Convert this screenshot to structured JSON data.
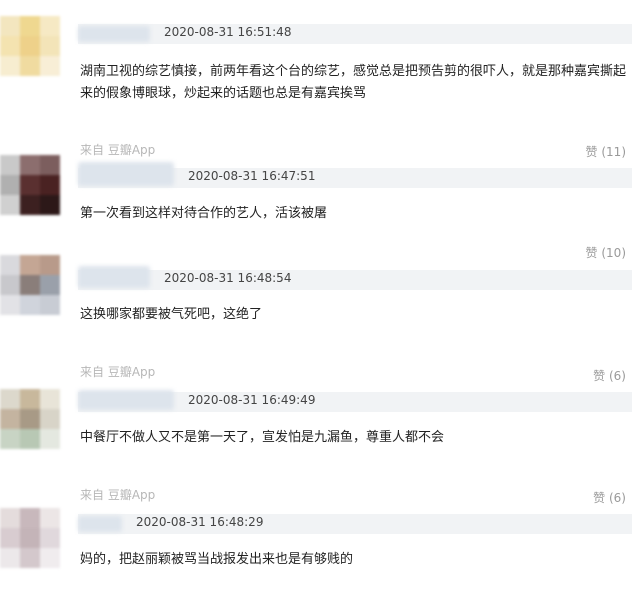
{
  "comments": [
    {
      "time": "2020-08-31 16:51:48",
      "text": "湖南卫视的综艺慎接，前两年看这个台的综艺，感觉总是把预告剪的很吓人，就是那种嘉宾撕起来的假象博眼球，炒起来的话题也总是有嘉宾挨骂",
      "source": "来自 豆瓣App",
      "likes": "赞 (11)"
    },
    {
      "time": "2020-08-31 16:47:51",
      "text": "第一次看到这样对待合作的艺人，活该被屠",
      "source": "",
      "likes": "赞 (10)"
    },
    {
      "time": "2020-08-31 16:48:54",
      "text": "这换哪家都要被气死吧，这绝了",
      "source": "来自 豆瓣App",
      "likes": "赞 (6)"
    },
    {
      "time": "2020-08-31 16:49:49",
      "text": "中餐厅不做人又不是第一天了，宣发怕是九漏鱼，尊重人都不会",
      "source": "来自 豆瓣App",
      "likes": "赞 (6)"
    },
    {
      "time": "2020-08-31 16:48:29",
      "text": "妈的，把赵丽颖被骂当战报发出来也是有够贱的",
      "source": "",
      "likes": ""
    }
  ],
  "avatar_colors": [
    [
      "#f3e6bf",
      "#efd890",
      "#f6e9c4",
      "#f4e3b0",
      "#eed18a",
      "#f3e4b8",
      "#f7edd0",
      "#f0dba0",
      "#f8eed6"
    ],
    [
      "#c9c9c9",
      "#8c6e6e",
      "#7c5e5e",
      "#b0b0b0",
      "#5a3030",
      "#4a2222",
      "#d0d0d0",
      "#3c2020",
      "#2c1818"
    ],
    [
      "#d9d9dd",
      "#c4a694",
      "#b89a8a",
      "#c8c8cc",
      "#8a7e7a",
      "#9aa0aa",
      "#e2e2e6",
      "#d0d4dc",
      "#c8ccd4"
    ],
    [
      "#dcd8cc",
      "#c8b89c",
      "#e8e4d8",
      "#c4b4a0",
      "#a89a86",
      "#d8d4c8",
      "#c8d4c4",
      "#b8c8b4",
      "#e4e8e0"
    ],
    [
      "#e4dcdc",
      "#c8b8bc",
      "#ece6e6",
      "#d8ccd0",
      "#c4b4b8",
      "#e0d8dc",
      "#ece8ea",
      "#d4c8cc",
      "#f0ecee"
    ]
  ]
}
